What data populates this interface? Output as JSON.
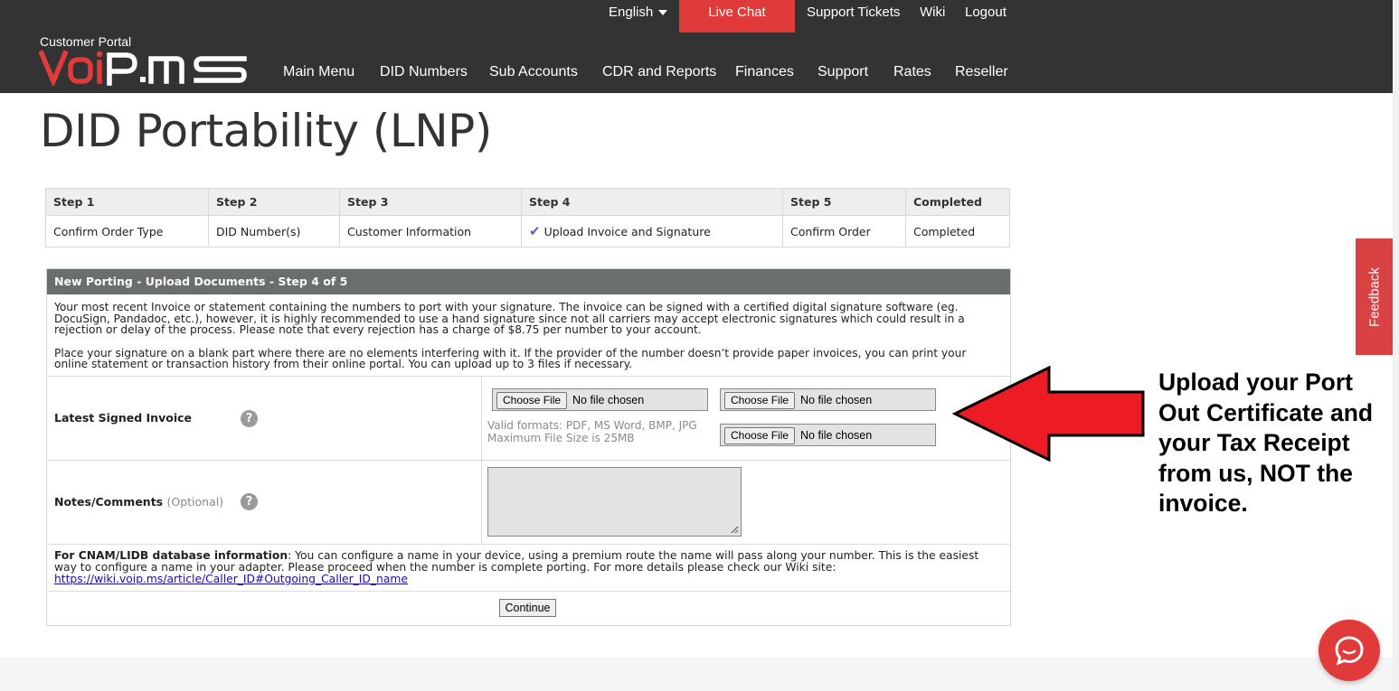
{
  "top_nav": {
    "language": "English",
    "live_chat": "Live Chat",
    "support_tickets": "Support Tickets",
    "wiki": "Wiki",
    "logout": "Logout"
  },
  "brand": {
    "subtitle": "Customer Portal",
    "logo_text": "VOiP.MS"
  },
  "main_nav": [
    "Main Menu",
    "DID Numbers",
    "Sub Accounts",
    "CDR and Reports",
    "Finances",
    "Support",
    "Rates",
    "Reseller"
  ],
  "page_title": "DID Portability (LNP)",
  "steps": {
    "headers": [
      "Step 1",
      "Step 2",
      "Step 3",
      "Step 4",
      "Step 5",
      "Completed"
    ],
    "values": [
      "Confirm Order Type",
      "DID Number(s)",
      "Customer Information",
      "Upload Invoice and Signature",
      "Confirm Order",
      "Completed"
    ]
  },
  "panel": {
    "title": "New Porting - Upload Documents - Step 4 of 5",
    "intro_1": "Your most recent Invoice or statement containing the numbers to port with your signature. The invoice can be signed with a certified digital signature software (eg. DocuSign, Pandadoc, etc.), however, it is highly recommended to use a hand signature since not all carriers may accept electronic signatures which could result in a rejection or delay of the process. Please note that every rejection has a charge of $8.75 per number to your account.",
    "intro_2": "Place your signature on a blank part where there are no elements interfering with it. If the provider of the number doesn’t provide paper invoices, you can print your online statement or transaction history from their online portal. You can upload up to 3 files if necessary.",
    "invoice_label": "Latest Signed Invoice",
    "choose_file": "Choose File",
    "no_file": "No file chosen",
    "formats": "Valid formats: PDF, MS Word, BMP, JPG",
    "max_size": "Maximum File Size is 25MB",
    "notes_label": "Notes/Comments",
    "notes_optional": "(Optional)",
    "help_glyph": "?",
    "cnam_bold": "For CNAM/LIDB database information",
    "cnam_text": ": You can configure a name in your device, using a premium route the name will pass along your number. This is the easiest way to configure a name in your adapter. Please proceed when the number is complete porting. For more details please check our Wiki site:",
    "cnam_link": "https://wiki.voip.ms/article/Caller_ID#Outgoing_Caller_ID_name",
    "continue": "Continue"
  },
  "annotation": "Upload your Port Out Certificate and your Tax Receipt from us, NOT the invoice.",
  "feedback": "Feedback",
  "colors": {
    "header_bg": "#333333",
    "accent_red": "#e03a3a",
    "arrow_red": "#ed1c24",
    "panel_head": "#6a6f6c"
  }
}
